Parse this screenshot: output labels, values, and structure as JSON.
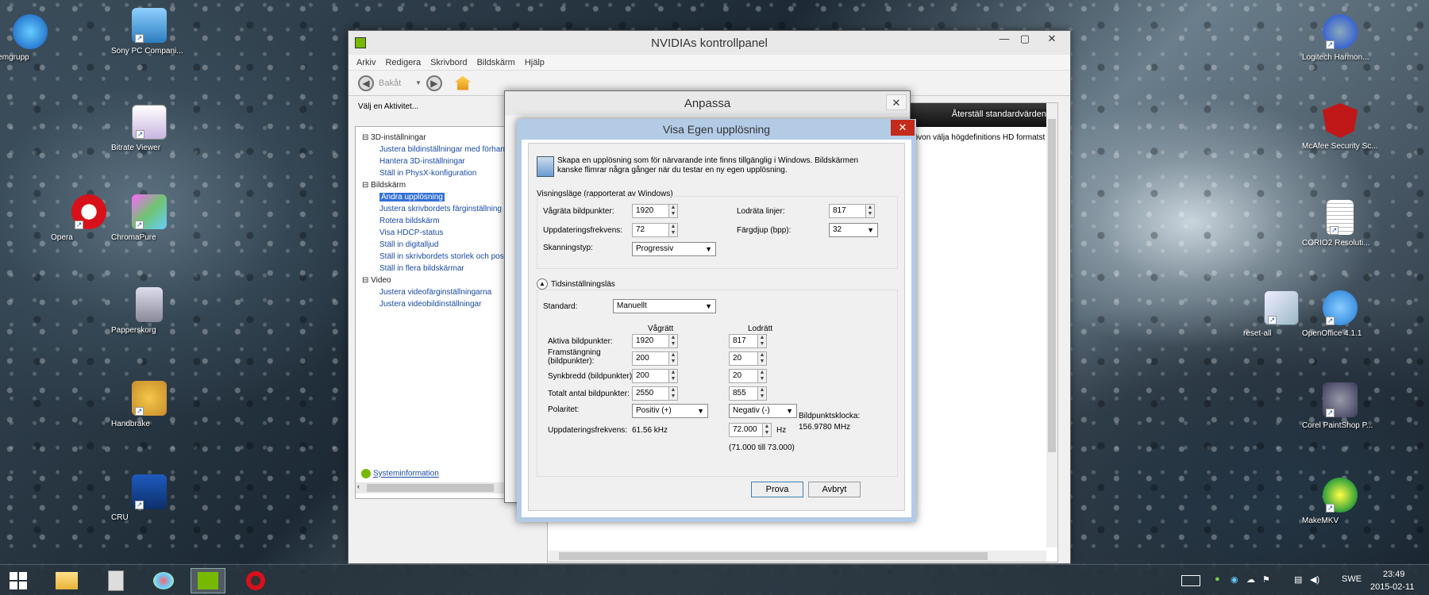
{
  "desktop": {
    "left_icons": [
      {
        "label": "Hemgrupp",
        "color": "#2a7bd1"
      },
      {
        "label": "Sony PC Compani...",
        "color": "#4aa3e0"
      },
      {
        "label": "Bitrate Viewer",
        "color": "#b8a0d8"
      },
      {
        "label": "Opera",
        "color": "#d8101a"
      },
      {
        "label": "ChromaPure",
        "color": "#6fc46f"
      },
      {
        "label": "Papperskorg",
        "color": "#9aaab5"
      },
      {
        "label": "Handbrake",
        "color": "#c98a2a"
      },
      {
        "label": "CRU",
        "color": "#1e5bbf"
      }
    ],
    "right_icons": [
      {
        "label": "Logitech Harmon...",
        "color": "#3b64d0"
      },
      {
        "label": "McAfee Security Sc...",
        "color": "#c01818"
      },
      {
        "label": "CORIO2 Resoluti...",
        "color": "#e8e8e8"
      },
      {
        "label": "reset-all",
        "color": "#9cb8c8"
      },
      {
        "label": "OpenOffice 4.1.1",
        "color": "#1f7ad6"
      },
      {
        "label": "Corel PaintShop P...",
        "color": "#3a3a5a"
      },
      {
        "label": "MakeMKV",
        "color": "#2e9f3a"
      }
    ]
  },
  "nvidia": {
    "title": "NVIDIAs kontrollpanel",
    "menu": [
      "Arkiv",
      "Redigera",
      "Skrivbord",
      "Bildskärm",
      "Hjälp"
    ],
    "back_label": "Bakåt",
    "task_label": "Välj en Aktivitet...",
    "tree": {
      "s1": "3D-inställningar",
      "s1a": "Justera bildinställningar med förhand",
      "s1b": "Hantera 3D-inställningar",
      "s1c": "Ställ in PhysX-konfiguration",
      "s2": "Bildskärm",
      "s2a": "Ändra upplösning",
      "s2b": "Justera skrivbordets färginställning",
      "s2c": "Rotera bildskärm",
      "s2d": "Visa HDCP-status",
      "s2e": "Ställ in digitalljud",
      "s2f": "Ställ in skrivbordets storlek och pos",
      "s2g": "Ställ in flera bildskärmar",
      "s3": "Video",
      "s3a": "Justera videofärginställningarna",
      "s3b": "Justera videobildinställningar"
    },
    "sysinfo": "Systeminformation",
    "restore": "Återställ standardvärden",
    "right_text": "övon välja högdefinitions HD formatst c"
  },
  "anpassa": {
    "title": "Anpassa"
  },
  "dialog": {
    "title": "Visa Egen upplösning",
    "intro": "Skapa en upplösning som för närvarande inte finns tillgänglig i Windows. Bildskärmen kanske flimrar några gånger när du testar en ny egen upplösning.",
    "group1": "Visningsläge (rapporterat av Windows)",
    "h_pixels_label": "Vågräta bildpunkter:",
    "h_pixels": "1920",
    "v_lines_label": "Lodräta linjer:",
    "v_lines": "817",
    "refresh_label": "Uppdateringsfrekvens:",
    "refresh": "72",
    "depth_label": "Färgdjup (bpp):",
    "depth": "32",
    "scan_label": "Skanningstyp:",
    "scan": "Progressiv",
    "group2": "Tidsinställningsläs",
    "standard_label": "Standard:",
    "standard": "Manuellt",
    "col_h": "Vågrätt",
    "col_v": "Lodrätt",
    "active_label": "Aktiva bildpunkter:",
    "active_h": "1920",
    "active_v": "817",
    "front_label": "Framstängning (bildpunkter):",
    "front_h": "200",
    "front_v": "20",
    "sync_label": "Synkbredd (bildpunkter):",
    "sync_h": "200",
    "sync_v": "20",
    "total_label": "Totalt antal bildpunkter:",
    "total_h": "2550",
    "total_v": "855",
    "polarity_label": "Polaritet:",
    "pol_h": "Positiv (+)",
    "pol_v": "Negativ (-)",
    "freq_label": "Uppdateringsfrekvens:",
    "freq_h": "61.56 kHz",
    "freq_v": "72.000",
    "hz": "Hz",
    "range": "(71.000 till 73.000)",
    "clock_label": "Bildpunktsklocka:",
    "clock": "156.9780 MHz",
    "test_btn": "Prova",
    "cancel_btn": "Avbryt"
  },
  "taskbar": {
    "lang": "SWE",
    "time": "23:49",
    "date": "2015-02-11"
  }
}
